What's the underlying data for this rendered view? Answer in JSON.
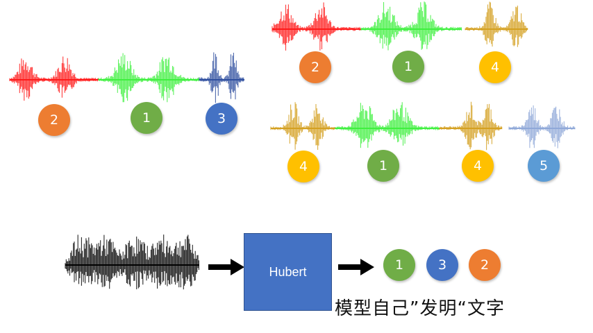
{
  "colors": {
    "red": "#ff1a1a",
    "green": "#3ff03f",
    "blue_dark": "#2f4f9f",
    "gold": "#d4a020",
    "blue_light": "#8fa8d8",
    "black": "#000000",
    "badge_orange": "#ed7d31",
    "badge_green": "#70ad47",
    "badge_blue": "#4472c4",
    "badge_yellow": "#ffc000",
    "badge_lightblue": "#5b9bd5",
    "box": "#4472c4"
  },
  "badges": {
    "g1": [
      "2",
      "1",
      "3"
    ],
    "g2": [
      "2",
      "1",
      "4"
    ],
    "g3": [
      "4",
      "1",
      "4",
      "5"
    ],
    "output": [
      "1",
      "3",
      "2"
    ]
  },
  "model": {
    "label": "Hubert"
  },
  "caption": "模型自己”发明“文字"
}
